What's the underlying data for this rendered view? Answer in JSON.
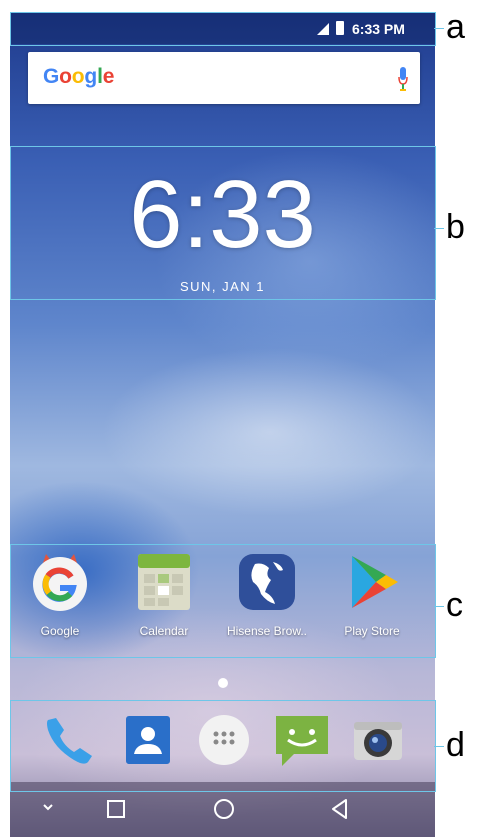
{
  "status_bar": {
    "time": "6:33 PM"
  },
  "search_bar": {
    "logo_text": "Google",
    "logo_colors": [
      "#4285F4",
      "#EA4335",
      "#FBBC05",
      "#4285F4",
      "#34A853",
      "#EA4335"
    ]
  },
  "clock": {
    "time": "6:33",
    "date": "SUN, JAN 1"
  },
  "apps": [
    {
      "label": "Google",
      "icon": "google-app-icon"
    },
    {
      "label": "Calendar",
      "icon": "calendar-app-icon"
    },
    {
      "label": "Hisense Brow..",
      "icon": "hisense-browser-icon"
    },
    {
      "label": "Play Store",
      "icon": "play-store-icon"
    }
  ],
  "dock": [
    {
      "icon": "phone-icon"
    },
    {
      "icon": "contacts-icon"
    },
    {
      "icon": "app-drawer-icon"
    },
    {
      "icon": "messaging-icon"
    },
    {
      "icon": "camera-icon"
    }
  ],
  "nav_bar": [
    {
      "icon": "chevron-down-icon"
    },
    {
      "icon": "recents-square-icon"
    },
    {
      "icon": "home-circle-icon"
    },
    {
      "icon": "back-triangle-icon"
    }
  ],
  "callouts": [
    "a",
    "b",
    "c",
    "d"
  ]
}
